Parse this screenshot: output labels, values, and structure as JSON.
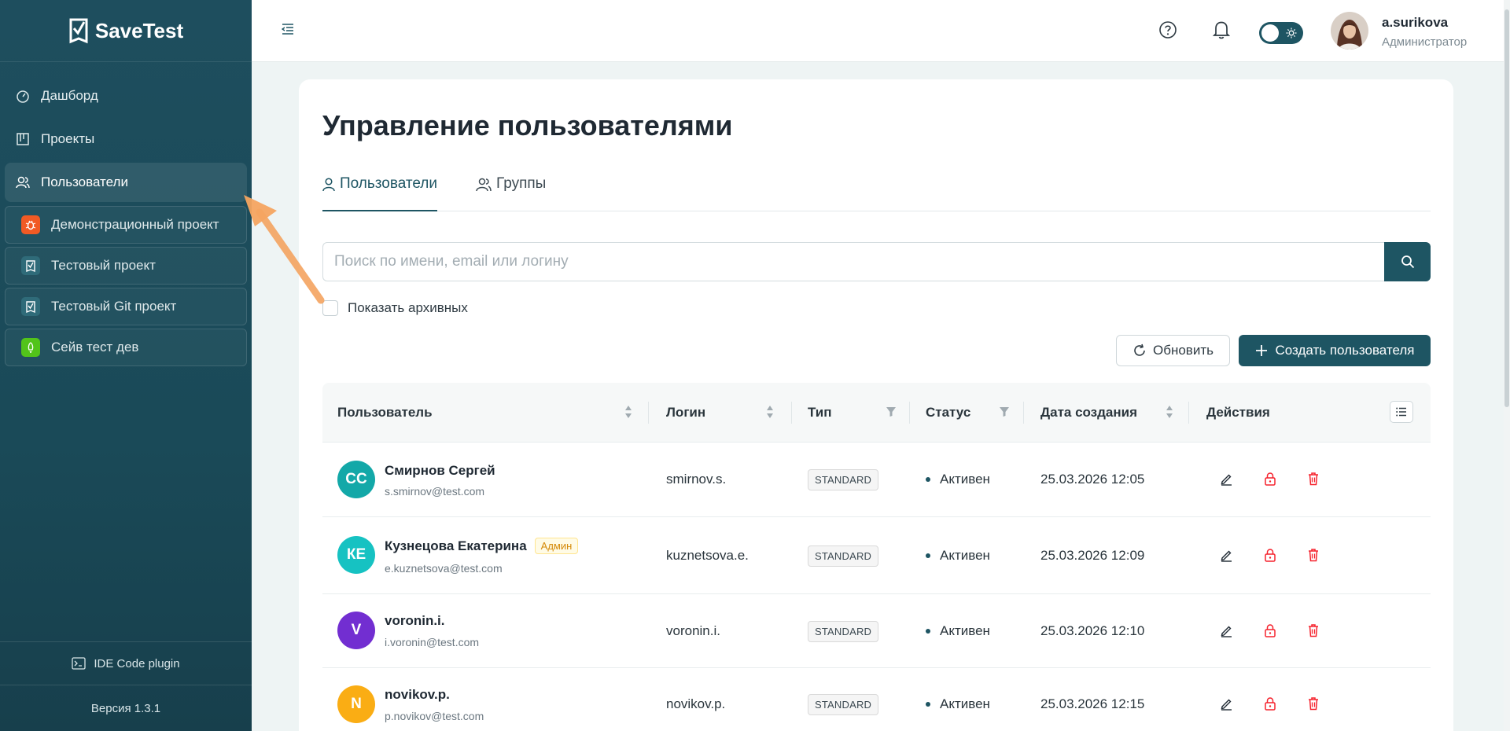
{
  "brand": {
    "name": "SaveTest"
  },
  "sidebar": {
    "nav": [
      {
        "label": "Дашборд",
        "icon": "dashboard-icon"
      },
      {
        "label": "Проекты",
        "icon": "projects-icon"
      },
      {
        "label": "Пользователи",
        "icon": "users-icon",
        "active": true
      }
    ],
    "projects": [
      {
        "label": "Демонстрационный проект",
        "color": "#f15a24"
      },
      {
        "label": "Тестовый проект",
        "color": "#2f6b79"
      },
      {
        "label": "Тестовый Git проект",
        "color": "#2f6b79"
      },
      {
        "label": "Сейв тест дев",
        "color": "#52c41a"
      }
    ],
    "plugin_label": "IDE Code plugin",
    "version": "Версия 1.3.1"
  },
  "header": {
    "user_name": "a.surikova",
    "user_role": "Администратор",
    "theme": "light"
  },
  "page": {
    "title": "Управление пользователями",
    "tabs": [
      {
        "label": "Пользователи",
        "active": true
      },
      {
        "label": "Группы"
      }
    ],
    "search_placeholder": "Поиск по имени, email или логину",
    "show_archived_label": "Показать архивных",
    "refresh_label": "Обновить",
    "create_label": "Создать пользователя"
  },
  "table": {
    "columns": [
      "Пользователь",
      "Логин",
      "Тип",
      "Статус",
      "Дата создания",
      "Действия"
    ],
    "rows": [
      {
        "initials": "СС",
        "avatar_color": "#13a8a8",
        "name": "Смирнов Сергей",
        "email": "s.smirnov@test.com",
        "badge": "",
        "login": "smirnov.s.",
        "type": "STANDARD",
        "status": "Активен",
        "created": "25.03.2026 12:05"
      },
      {
        "initials": "КЕ",
        "avatar_color": "#16c2c2",
        "name": "Кузнецова Екатерина",
        "email": "e.kuznetsova@test.com",
        "badge": "Админ",
        "login": "kuznetsova.e.",
        "type": "STANDARD",
        "status": "Активен",
        "created": "25.03.2026 12:09"
      },
      {
        "initials": "V",
        "avatar_color": "#722ed1",
        "name": "voronin.i.",
        "email": "i.voronin@test.com",
        "badge": "",
        "login": "voronin.i.",
        "type": "STANDARD",
        "status": "Активен",
        "created": "25.03.2026 12:10"
      },
      {
        "initials": "N",
        "avatar_color": "#faad14",
        "name": "novikov.p.",
        "email": "p.novikov@test.com",
        "badge": "",
        "login": "novikov.p.",
        "type": "STANDARD",
        "status": "Активен",
        "created": "25.03.2026 12:15"
      }
    ]
  }
}
